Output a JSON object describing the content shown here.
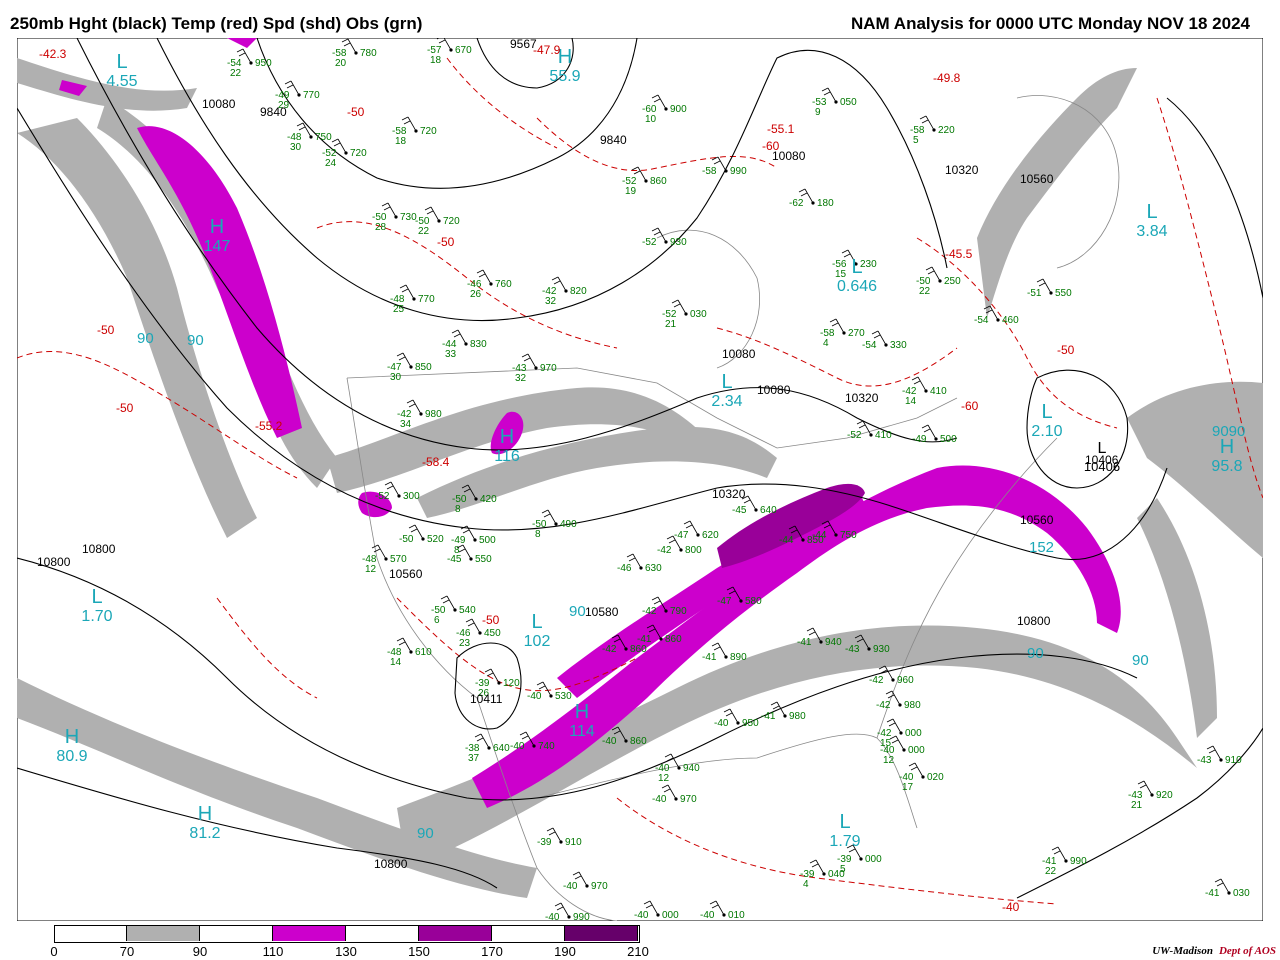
{
  "header": {
    "left": "250mb Hght (black) Temp (red) Spd (shd) Obs (grn)",
    "right": "NAM Analysis for 0000 UTC Monday  NOV 18 2024"
  },
  "legend": {
    "ticks": [
      "0",
      "70",
      "90",
      "110",
      "130",
      "150",
      "170",
      "190",
      "210"
    ],
    "bins": [
      {
        "color": "#ffffff"
      },
      {
        "color": "#b0b0b0"
      },
      {
        "color": "#ffffff"
      },
      {
        "color": "#cc00cc"
      },
      {
        "color": "#ffffff"
      },
      {
        "color": "#990099"
      },
      {
        "color": "#ffffff"
      },
      {
        "color": "#66006a"
      }
    ]
  },
  "credit": {
    "org": "UW-Madison",
    "dept": "Dept of AOS"
  },
  "colors": {
    "height": "#000000",
    "temp": "#cc0000",
    "obs": "#007700",
    "pressure_labels": "#1ba7b7",
    "speed_gray": "#b0b0b0",
    "speed_magenta": "#cc00cc",
    "speed_purple": "#990099",
    "borders": "#888888"
  },
  "centers": [
    {
      "letter": "L",
      "value": "4.55"
    },
    {
      "letter": "H",
      "value": "147"
    },
    {
      "letter": "H",
      "value": "55.9"
    },
    {
      "letter": "H",
      "value": "116"
    },
    {
      "letter": "L",
      "value": "1.70"
    },
    {
      "letter": "H",
      "value": "80.9"
    },
    {
      "letter": "H",
      "value": "81.2"
    },
    {
      "letter": "L",
      "value": "2.34"
    },
    {
      "letter": "L",
      "value": "0.646"
    },
    {
      "letter": "L",
      "value": "2.10"
    },
    {
      "letter": "L",
      "value": "3.84"
    },
    {
      "letter": "H",
      "value": "95.8"
    },
    {
      "letter": "L",
      "value": "1.79"
    },
    {
      "letter": "H",
      "value": "114"
    },
    {
      "letter": "L",
      "value": "102"
    },
    {
      "letter": "L",
      "value": "10406"
    }
  ],
  "height_labels": [
    "10080",
    "9840",
    "9567",
    "9840",
    "10080",
    "10320",
    "10560",
    "10080",
    "10080",
    "10320",
    "10320",
    "10560",
    "10560",
    "10800",
    "10800",
    "10800",
    "10800",
    "10411",
    "10580",
    "10406"
  ],
  "speed_labels": [
    "90",
    "90",
    "90",
    "90",
    "90",
    "152",
    "90",
    "9090"
  ],
  "temp_labels": [
    "-42.3",
    "-47.9",
    "-55.1",
    "-60",
    "-49.8",
    "-50",
    "-50",
    "-50",
    "-50",
    "-55.2",
    "-58.4",
    "-45.5",
    "-50",
    "-60",
    "-50",
    "-40"
  ],
  "obs": [
    {
      "t": "-58",
      "d": "20",
      "h": "780"
    },
    {
      "t": "-57",
      "d": "18",
      "h": "670"
    },
    {
      "t": "-54",
      "d": "22",
      "h": "950"
    },
    {
      "t": "-49",
      "d": "29",
      "h": "770"
    },
    {
      "t": "-48",
      "d": "30",
      "h": "750"
    },
    {
      "t": "-52",
      "d": "24",
      "h": "720"
    },
    {
      "t": "-58",
      "d": "18",
      "h": "720"
    },
    {
      "t": "-60",
      "d": "10",
      "h": "900"
    },
    {
      "t": "-53",
      "d": "9",
      "h": "050"
    },
    {
      "t": "-58",
      "d": "5",
      "h": "220"
    },
    {
      "t": "-52",
      "d": "19",
      "h": "860"
    },
    {
      "t": "-58",
      "d": "",
      "h": "990"
    },
    {
      "t": "-62",
      "d": "",
      "h": "180"
    },
    {
      "t": "-50",
      "d": "28",
      "h": "730"
    },
    {
      "t": "-50",
      "d": "22",
      "h": "720"
    },
    {
      "t": "-52",
      "d": "",
      "h": "930"
    },
    {
      "t": "-56",
      "d": "15",
      "h": "230"
    },
    {
      "t": "-50",
      "d": "22",
      "h": "250"
    },
    {
      "t": "-46",
      "d": "26",
      "h": "760"
    },
    {
      "t": "-42",
      "d": "32",
      "h": "820"
    },
    {
      "t": "-48",
      "d": "25",
      "h": "770"
    },
    {
      "t": "-52",
      "d": "21",
      "h": "030"
    },
    {
      "t": "-58",
      "d": "4",
      "h": "270"
    },
    {
      "t": "-51",
      "d": "",
      "h": "550"
    },
    {
      "t": "-54",
      "d": "",
      "h": "460"
    },
    {
      "t": "-44",
      "d": "33",
      "h": "830"
    },
    {
      "t": "-54",
      "d": "",
      "h": "330"
    },
    {
      "t": "-43",
      "d": "32",
      "h": "970"
    },
    {
      "t": "-47",
      "d": "30",
      "h": "850"
    },
    {
      "t": "-42",
      "d": "34",
      "h": "980"
    },
    {
      "t": "-42",
      "d": "14",
      "h": "410"
    },
    {
      "t": "-52",
      "d": "",
      "h": "410"
    },
    {
      "t": "-49",
      "d": "",
      "h": "500"
    },
    {
      "t": "-50",
      "d": "8",
      "h": "420"
    },
    {
      "t": "-50",
      "d": "8",
      "h": "490"
    },
    {
      "t": "-49",
      "d": "8",
      "h": "500"
    },
    {
      "t": "-48",
      "d": "12",
      "h": "570"
    },
    {
      "t": "-50",
      "d": "6",
      "h": "540"
    },
    {
      "t": "-46",
      "d": "23",
      "h": "450"
    },
    {
      "t": "-48",
      "d": "14",
      "h": "610"
    },
    {
      "t": "-39",
      "d": "26",
      "h": "120"
    },
    {
      "t": "-40",
      "d": "",
      "h": "530"
    },
    {
      "t": "-42",
      "d": "",
      "h": "790"
    },
    {
      "t": "-42",
      "d": "",
      "h": "860"
    },
    {
      "t": "-41",
      "d": "",
      "h": "860"
    },
    {
      "t": "-41",
      "d": "",
      "h": "890"
    },
    {
      "t": "-41",
      "d": "",
      "h": "940"
    },
    {
      "t": "-43",
      "d": "",
      "h": "930"
    },
    {
      "t": "-42",
      "d": "",
      "h": "960"
    },
    {
      "t": "-42",
      "d": "",
      "h": "980"
    },
    {
      "t": "-42",
      "d": "15",
      "h": "000"
    },
    {
      "t": "-40",
      "d": "12",
      "h": "000"
    },
    {
      "t": "-40",
      "d": "17",
      "h": "020"
    },
    {
      "t": "-40",
      "d": "",
      "h": "950"
    },
    {
      "t": "-41",
      "d": "",
      "h": "980"
    },
    {
      "t": "-40",
      "d": "",
      "h": "860"
    },
    {
      "t": "-40",
      "d": "12",
      "h": "940"
    },
    {
      "t": "-40",
      "d": "",
      "h": "970"
    },
    {
      "t": "-39",
      "d": "",
      "h": "910"
    },
    {
      "t": "-40",
      "d": "",
      "h": "970"
    },
    {
      "t": "-40",
      "d": "",
      "h": "990"
    },
    {
      "t": "-40",
      "d": "",
      "h": "000"
    },
    {
      "t": "-40",
      "d": "",
      "h": "010"
    },
    {
      "t": "-39",
      "d": "4",
      "h": "040"
    },
    {
      "t": "-39",
      "d": "5",
      "h": "000"
    },
    {
      "t": "-41",
      "d": "22",
      "h": "990"
    },
    {
      "t": "-43",
      "d": "21",
      "h": "920"
    },
    {
      "t": "-43",
      "d": "",
      "h": "910"
    },
    {
      "t": "-41",
      "d": "",
      "h": "030"
    },
    {
      "t": "-38",
      "d": "37",
      "h": "640"
    },
    {
      "t": "-40",
      "d": "",
      "h": "740"
    },
    {
      "t": "-52",
      "d": "",
      "h": "300"
    },
    {
      "t": "-50",
      "d": "",
      "h": "520"
    },
    {
      "t": "-45",
      "d": "",
      "h": "550"
    },
    {
      "t": "-42",
      "d": "",
      "h": "800"
    },
    {
      "t": "-47",
      "d": "",
      "h": "620"
    },
    {
      "t": "-44",
      "d": "",
      "h": "850"
    },
    {
      "t": "-44",
      "d": "",
      "h": "750"
    },
    {
      "t": "-45",
      "d": "",
      "h": "640"
    },
    {
      "t": "-46",
      "d": "",
      "h": "630"
    },
    {
      "t": "-47",
      "d": "",
      "h": "580"
    }
  ]
}
